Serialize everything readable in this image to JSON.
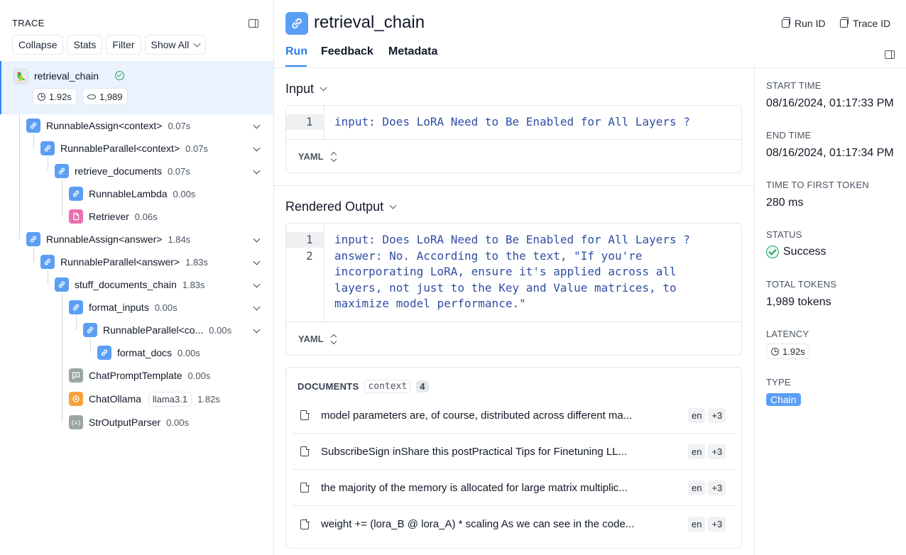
{
  "trace": {
    "title": "TRACE",
    "toolbar": {
      "collapse": "Collapse",
      "stats": "Stats",
      "filter": "Filter",
      "show_all": "Show All"
    },
    "root": {
      "name": "retrieval_chain",
      "latency": "1.92s",
      "tokens": "1,989"
    },
    "nodes": [
      {
        "name": "RunnableAssign<context>",
        "time": "0.07s"
      },
      {
        "name": "RunnableParallel<context>",
        "time": "0.07s"
      },
      {
        "name": "retrieve_documents",
        "time": "0.07s"
      },
      {
        "name": "RunnableLambda",
        "time": "0.00s"
      },
      {
        "name": "Retriever",
        "time": "0.06s"
      },
      {
        "name": "RunnableAssign<answer>",
        "time": "1.84s"
      },
      {
        "name": "RunnableParallel<answer>",
        "time": "1.83s"
      },
      {
        "name": "stuff_documents_chain",
        "time": "1.83s"
      },
      {
        "name": "format_inputs",
        "time": "0.00s"
      },
      {
        "name": "RunnableParallel<co...",
        "time": "0.00s"
      },
      {
        "name": "format_docs",
        "time": "0.00s"
      },
      {
        "name": "ChatPromptTemplate",
        "time": "0.00s"
      },
      {
        "name": "ChatOllama",
        "model": "llama3.1",
        "time": "1.82s"
      },
      {
        "name": "StrOutputParser",
        "time": "0.00s"
      }
    ]
  },
  "header": {
    "title": "retrieval_chain",
    "run_id": "Run ID",
    "trace_id": "Trace ID",
    "tabs": [
      "Run",
      "Feedback",
      "Metadata"
    ]
  },
  "input": {
    "title": "Input",
    "line_numbers": [
      "1"
    ],
    "lines": [
      "input: Does LoRA Need to Be Enabled for All Layers ?"
    ],
    "format": "YAML"
  },
  "output": {
    "title": "Rendered Output",
    "line_numbers": [
      "1",
      "2"
    ],
    "lines": [
      "input: Does LoRA Need to Be Enabled for All Layers ?",
      "answer: No. According to the text, \"If you're",
      "incorporating LoRA, ensure it's applied across all",
      "layers, not just to the Key and Value matrices, to",
      "maximize model performance.\""
    ],
    "format": "YAML"
  },
  "documents": {
    "label": "DOCUMENTS",
    "context": "context",
    "count": "4",
    "items": [
      {
        "text": "model parameters are, of course, distributed across different ma...",
        "lang": "en",
        "more": "+3"
      },
      {
        "text": "SubscribeSign inShare this postPractical Tips for Finetuning LL...",
        "lang": "en",
        "more": "+3"
      },
      {
        "text": "the majority of the memory is allocated for large matrix multiplic...",
        "lang": "en",
        "more": "+3"
      },
      {
        "text": "weight += (lora_B @ lora_A) * scaling As we can see in the code...",
        "lang": "en",
        "more": "+3"
      }
    ]
  },
  "meta": {
    "start_time_label": "START TIME",
    "start_time": "08/16/2024, 01:17:33 PM",
    "end_time_label": "END TIME",
    "end_time": "08/16/2024, 01:17:34 PM",
    "ttft_label": "TIME TO FIRST TOKEN",
    "ttft": "280 ms",
    "status_label": "STATUS",
    "status": "Success",
    "tokens_label": "TOTAL TOKENS",
    "tokens": "1,989 tokens",
    "latency_label": "LATENCY",
    "latency": "1.92s",
    "type_label": "TYPE",
    "type": "Chain"
  },
  "colors": {
    "accent": "#2b7de9",
    "chain_icon": "#5b9ef5",
    "retriever_icon": "#ea6fb1",
    "llm_icon": "#f6a13b",
    "success": "#22a05a"
  }
}
